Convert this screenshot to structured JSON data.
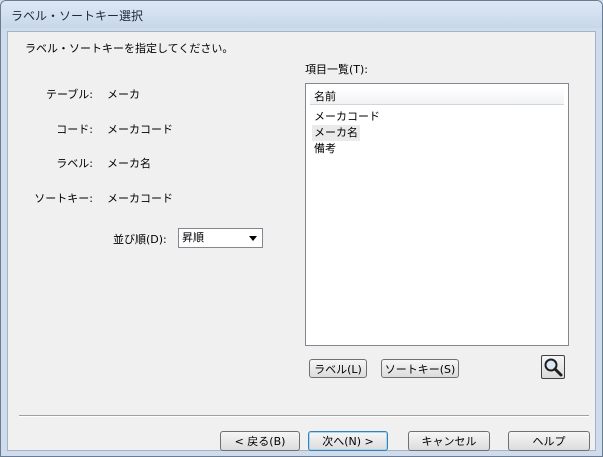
{
  "window": {
    "title": "ラベル・ソートキー選択"
  },
  "instruction": "ラベル・ソートキーを指定してください。",
  "fields": [
    {
      "label": "テーブル:",
      "value": "メーカ"
    },
    {
      "label": "コード:",
      "value": "メーカコード"
    },
    {
      "label": "ラベル:",
      "value": "メーカ名"
    },
    {
      "label": "ソートキー:",
      "value": "メーカコード"
    }
  ],
  "sort_order": {
    "label": "並び順(D):",
    "value": "昇順"
  },
  "items_list": {
    "label": "項目一覧(T):",
    "header": "名前",
    "items": [
      "メーカコード",
      "メーカ名",
      "備考"
    ],
    "selected_index": 1
  },
  "buttons": {
    "label": "ラベル(L)",
    "sortkey": "ソートキー(S)",
    "back": "< 戻る(B)",
    "next": "次へ(N) >",
    "cancel": "キャンセル",
    "help": "ヘルプ"
  },
  "icons": {
    "search": "magnifier-icon"
  },
  "colors": {
    "window_frame": "#cfdcec",
    "client_bg": "#f0f0f0"
  }
}
